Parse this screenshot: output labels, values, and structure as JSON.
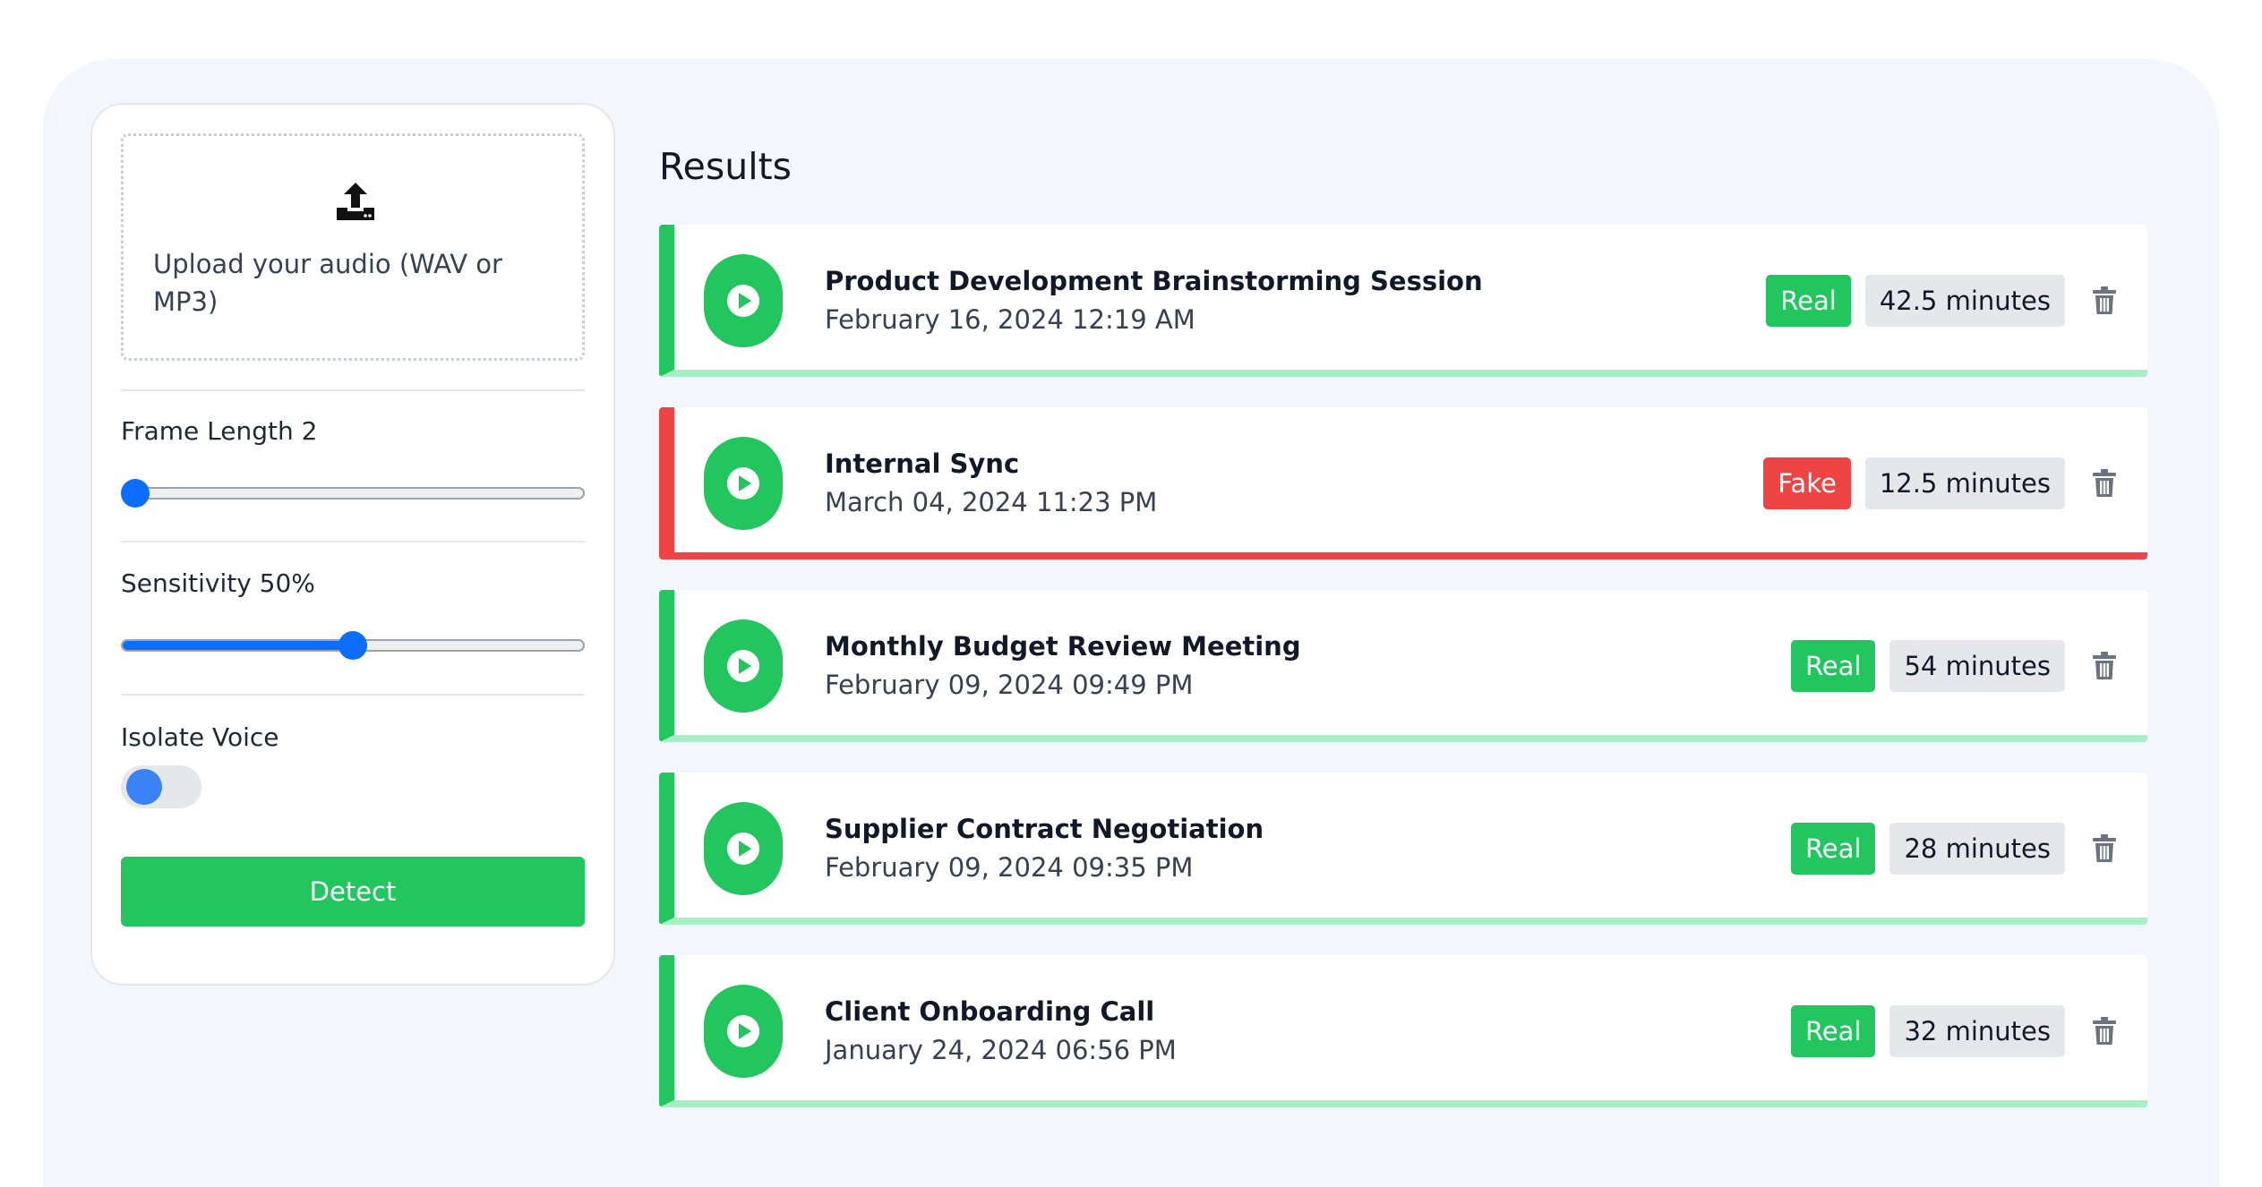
{
  "upload": {
    "text": "Upload your audio (WAV or MP3)",
    "icon": "upload-icon"
  },
  "controls": {
    "frame_length": {
      "label": "Frame Length 2",
      "value_fraction": 0.0
    },
    "sensitivity": {
      "label": "Sensitivity 50%",
      "value_fraction": 0.5
    },
    "isolate_voice": {
      "label": "Isolate Voice",
      "enabled": false
    },
    "detect_label": "Detect"
  },
  "results": {
    "title": "Results",
    "items": [
      {
        "title": "Product Development Brainstorming Session",
        "date": "February 16, 2024 12:19 AM",
        "verdict": "Real",
        "duration": "42.5 minutes"
      },
      {
        "title": "Internal Sync",
        "date": "March 04, 2024 11:23 PM",
        "verdict": "Fake",
        "duration": "12.5 minutes"
      },
      {
        "title": "Monthly Budget Review Meeting",
        "date": "February 09, 2024 09:49 PM",
        "verdict": "Real",
        "duration": "54 minutes"
      },
      {
        "title": "Supplier Contract Negotiation",
        "date": "February 09, 2024 09:35 PM",
        "verdict": "Real",
        "duration": "28 minutes"
      },
      {
        "title": "Client Onboarding Call",
        "date": "January 24, 2024 06:56 PM",
        "verdict": "Real",
        "duration": "32 minutes"
      }
    ]
  },
  "colors": {
    "real": "#22c55e",
    "fake": "#ef4444",
    "accent_blue": "#0d6efd",
    "panel_bg": "#f4f6fd"
  }
}
